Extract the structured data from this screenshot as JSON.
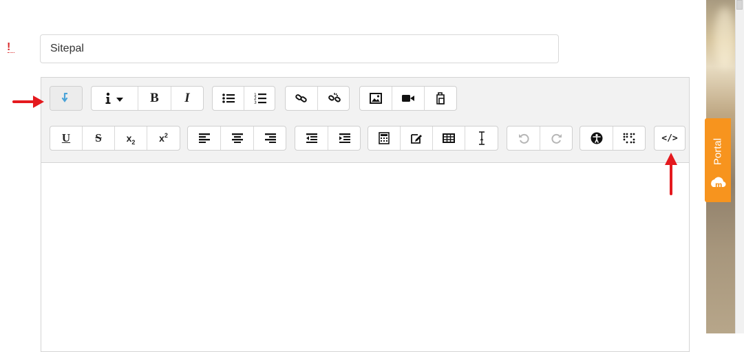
{
  "form": {
    "title_value": "Sitepal"
  },
  "toolbar": {
    "row1": [
      {
        "name": "toolbar-toggle-button",
        "icon": "toggle-arrow-icon",
        "label": ""
      },
      {
        "name": "style-dropdown-button",
        "icon": "info-caret-icon",
        "label": ""
      },
      {
        "name": "bold-button",
        "icon": "bold-icon",
        "label": "B"
      },
      {
        "name": "italic-button",
        "icon": "italic-icon",
        "label": "I"
      },
      {
        "name": "bullet-list-button",
        "icon": "unordered-list-icon",
        "label": ""
      },
      {
        "name": "numbered-list-button",
        "icon": "ordered-list-icon",
        "label": ""
      },
      {
        "name": "link-button",
        "icon": "link-icon",
        "label": ""
      },
      {
        "name": "unlink-button",
        "icon": "unlink-icon",
        "label": ""
      },
      {
        "name": "image-button",
        "icon": "image-icon",
        "label": ""
      },
      {
        "name": "media-button",
        "icon": "video-camera-icon",
        "label": ""
      },
      {
        "name": "manage-files-button",
        "icon": "files-icon",
        "label": ""
      }
    ],
    "row2": [
      {
        "name": "underline-button",
        "icon": "underline-icon",
        "label": "U"
      },
      {
        "name": "strikethrough-button",
        "icon": "strikethrough-icon",
        "label": "S"
      },
      {
        "name": "subscript-button",
        "icon": "subscript-icon",
        "label": "x",
        "small": "2"
      },
      {
        "name": "superscript-button",
        "icon": "superscript-icon",
        "label": "x",
        "small": "2"
      },
      {
        "name": "align-left-button",
        "icon": "align-left-icon",
        "label": ""
      },
      {
        "name": "align-center-button",
        "icon": "align-center-icon",
        "label": ""
      },
      {
        "name": "align-right-button",
        "icon": "align-right-icon",
        "label": ""
      },
      {
        "name": "outdent-button",
        "icon": "outdent-icon",
        "label": ""
      },
      {
        "name": "indent-button",
        "icon": "indent-icon",
        "label": ""
      },
      {
        "name": "equation-button",
        "icon": "calculator-icon",
        "label": ""
      },
      {
        "name": "special-char-button",
        "icon": "edit-icon",
        "label": ""
      },
      {
        "name": "table-button",
        "icon": "table-icon",
        "label": ""
      },
      {
        "name": "clear-formatting-button",
        "icon": "text-cursor-icon",
        "label": ""
      },
      {
        "name": "undo-button",
        "icon": "undo-icon",
        "label": ""
      },
      {
        "name": "redo-button",
        "icon": "redo-icon",
        "label": ""
      },
      {
        "name": "accessibility-checker-button",
        "icon": "accessibility-icon",
        "label": ""
      },
      {
        "name": "screenreader-helper-button",
        "icon": "braille-icon",
        "label": ""
      },
      {
        "name": "html-source-button",
        "icon": "code-icon",
        "label": "</>"
      }
    ]
  },
  "portal": {
    "label": "Portal",
    "accent": "#f7941e"
  },
  "annotations": {
    "arrow_color": "#e4191e"
  }
}
